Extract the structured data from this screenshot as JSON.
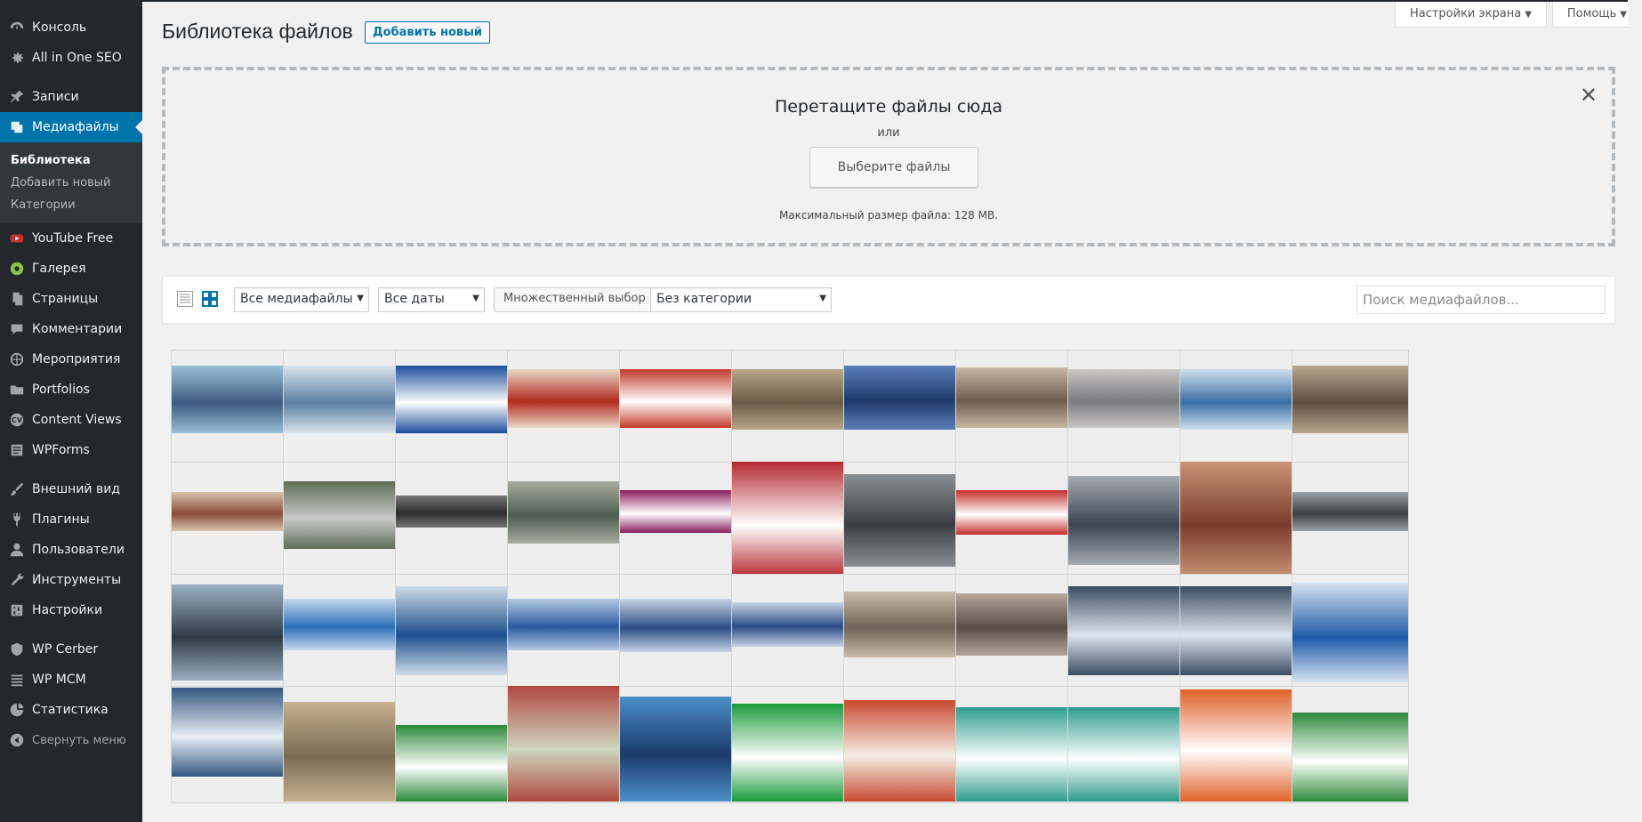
{
  "sidebar": {
    "items": [
      {
        "label": "Консоль",
        "icon": "dashboard-icon"
      },
      {
        "label": "All in One SEO",
        "icon": "gear-icon"
      },
      {
        "label": "Записи",
        "icon": "pin-icon"
      },
      {
        "label": "Медиафайлы",
        "icon": "media-icon"
      },
      {
        "label": "YouTube Free",
        "icon": "youtube-icon"
      },
      {
        "label": "Галерея",
        "icon": "gallery-icon"
      },
      {
        "label": "Страницы",
        "icon": "pages-icon"
      },
      {
        "label": "Комментарии",
        "icon": "comment-icon"
      },
      {
        "label": "Мероприятия",
        "icon": "globe-icon"
      },
      {
        "label": "Portfolios",
        "icon": "folder-icon"
      },
      {
        "label": "Content Views",
        "icon": "cv-icon"
      },
      {
        "label": "WPForms",
        "icon": "forms-icon"
      },
      {
        "label": "Внешний вид",
        "icon": "brush-icon"
      },
      {
        "label": "Плагины",
        "icon": "plugin-icon"
      },
      {
        "label": "Пользователи",
        "icon": "users-icon"
      },
      {
        "label": "Инструменты",
        "icon": "wrench-icon"
      },
      {
        "label": "Настройки",
        "icon": "settings-icon"
      },
      {
        "label": "WP Cerber",
        "icon": "shield-icon"
      },
      {
        "label": "WP MCM",
        "icon": "list-icon"
      },
      {
        "label": "Статистика",
        "icon": "chart-icon"
      }
    ],
    "submenu": [
      "Библиотека",
      "Добавить новый",
      "Категории"
    ],
    "collapse_label": "Свернуть меню"
  },
  "header": {
    "title": "Библиотека файлов",
    "add_new": "Добавить новый",
    "screen_options": "Настройки экрана",
    "help": "Помощь"
  },
  "uploader": {
    "title": "Перетащите файлы сюда",
    "or": "или",
    "select_button": "Выберите файлы",
    "max_size": "Максимальный размер файла: 128 MB."
  },
  "toolbar": {
    "type_filter": "Все медиафайлы",
    "date_filter": "Все даты",
    "bulk_select": "Множественный выбор",
    "category_filter": "Без категории",
    "search_placeholder": "Поиск медиафайлов..."
  },
  "colors": {
    "sidebar_bg": "#23282d",
    "accent": "#0073aa"
  }
}
